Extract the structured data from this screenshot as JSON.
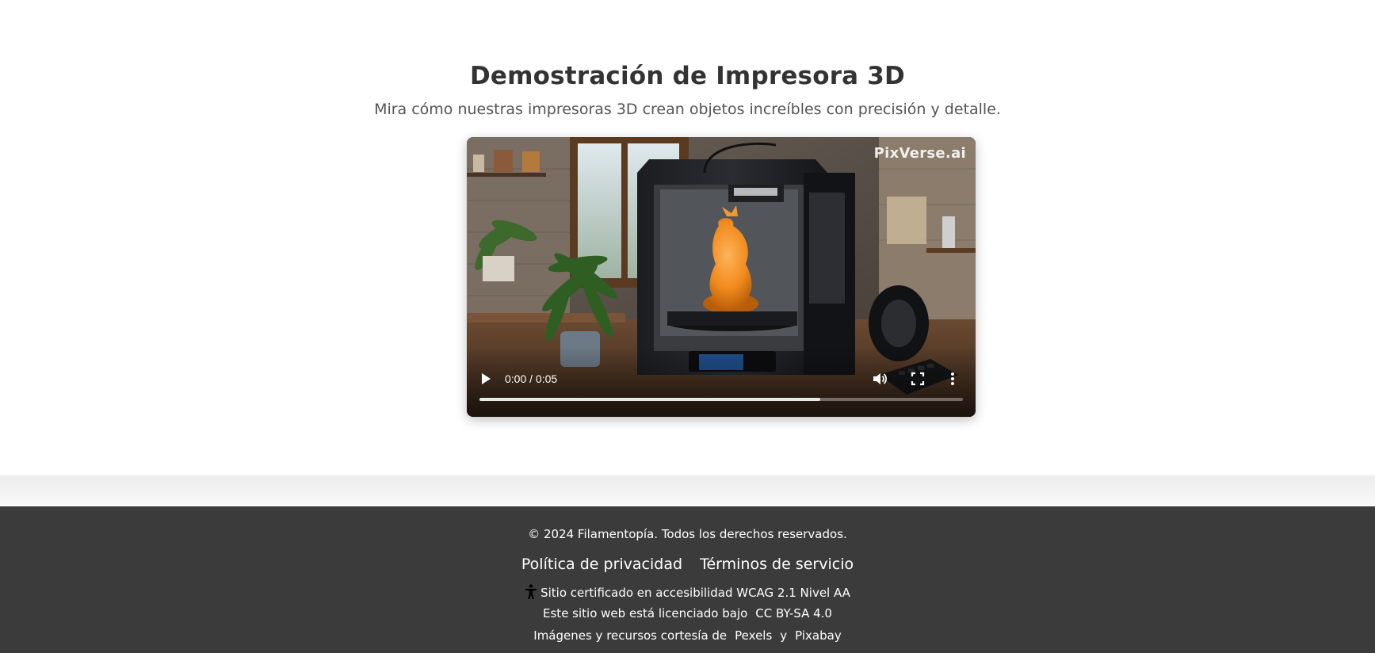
{
  "demo": {
    "title": "Demostración de Impresora 3D",
    "subtitle": "Mira cómo nuestras impresoras 3D crean objetos increíbles con precisión y detalle."
  },
  "video": {
    "watermark": "PixVerse.ai",
    "time": "0:00 / 0:05",
    "progress": 0.705,
    "icons": [
      "play-icon",
      "volume-icon",
      "fullscreen-icon",
      "more-options-icon"
    ]
  },
  "footer": {
    "copyright": "© 2024 Filamentopía. Todos los derechos reservados.",
    "links": {
      "privacy": "Política de privacidad",
      "terms": "Términos de servicio"
    },
    "accessibility": "Sitio certificado en accesibilidad WCAG 2.1 Nivel AA",
    "license_text": "Este sitio web está licenciado bajo",
    "license_link": "CC BY-SA 4.0",
    "credits_text": "Imágenes y recursos cortesía de",
    "credits_link_1": "Pexels",
    "credits_and": "y",
    "credits_link_2": "Pixabay"
  },
  "colors": {
    "footer_bg": "#3b3b3b",
    "title": "#333333",
    "accent_orange": "#f08a1c"
  }
}
